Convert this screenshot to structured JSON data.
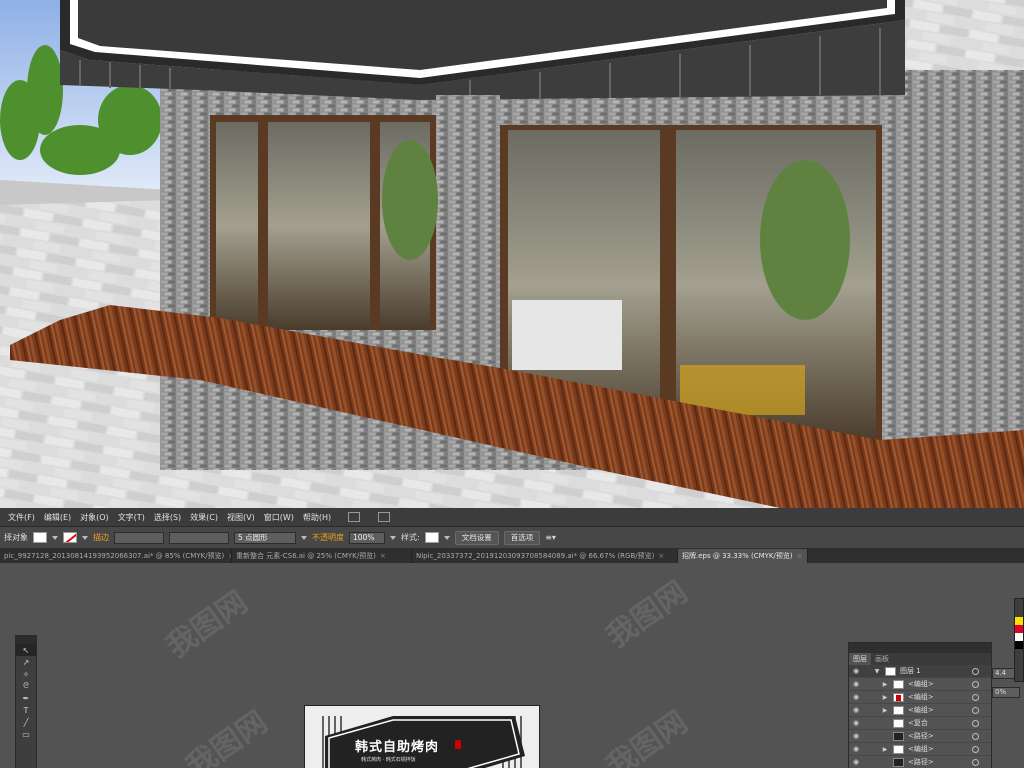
{
  "menu": [
    "文件(F)",
    "编辑(E)",
    "对象(O)",
    "文字(T)",
    "选择(S)",
    "效果(C)",
    "视图(V)",
    "窗口(W)",
    "帮助(H)"
  ],
  "control": {
    "selection_label": "择对象",
    "stroke_label": "描边",
    "brush_value": "5 点圆形",
    "opacity_label": "不透明度",
    "opacity_value": "100%",
    "style_label": "样式:",
    "doc_setup": "文档设置",
    "prefs": "首选项"
  },
  "tabs": [
    {
      "label": "pic_9927128_20130814193952066307.ai* @ 85% (CMYK/预览)",
      "active": false
    },
    {
      "label": "重新整合 元素-CS6.ai @ 25% (CMYK/预览)",
      "active": false
    },
    {
      "label": "Nipic_20337372_20191203093708584089.ai* @ 66.67% (RGB/预览)",
      "active": false
    },
    {
      "label": "招牌.eps @ 33.33% (CMYK/预览)",
      "active": true
    }
  ],
  "artboard": {
    "title": "韩式自助烤肉",
    "subtitle": "韩式烤肉 · 韩式石锅拌饭"
  },
  "layers": {
    "tab_layers": "图层",
    "tab_artboards": "画板",
    "layer_name": "图层 1",
    "rows": [
      "<编组>",
      "<编组>",
      "<编组>",
      "<复合",
      "<路径>",
      "<编组>",
      "<路径>"
    ]
  },
  "side_values": {
    "v1": "4.4",
    "v2": "0%"
  },
  "watermark": "我图网"
}
